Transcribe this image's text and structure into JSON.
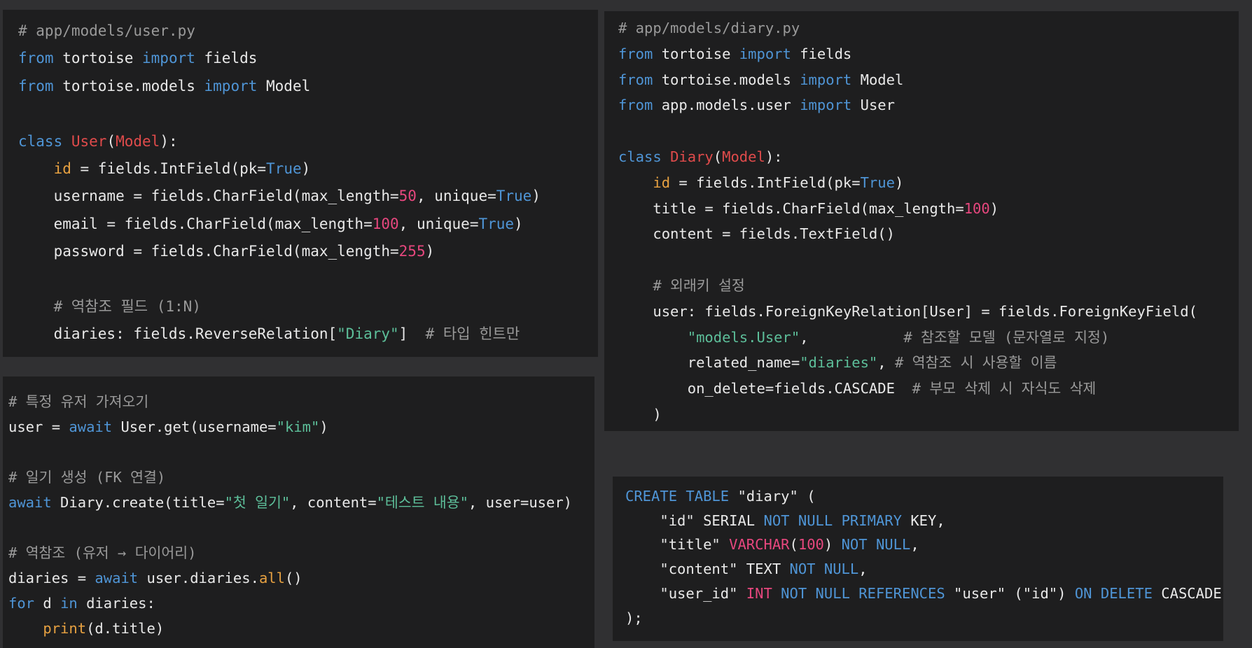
{
  "theme": {
    "background": "#303032",
    "panel": "#1e1e1f",
    "text": "#e9e9e9",
    "keyword": "#4f95d6",
    "class_name": "#e04b4b",
    "number": "#e7477e",
    "string": "#5dbf9a",
    "function": "#e7a141",
    "comment": "#9a9a9a"
  },
  "panels": [
    {
      "name": "user-model-code-panel",
      "language": "python",
      "lines": [
        [
          {
            "t": "# app/models/user.py",
            "c": "cmt"
          }
        ],
        [
          {
            "t": "from",
            "c": "kw"
          },
          {
            "t": " tortoise ",
            "c": "pl"
          },
          {
            "t": "import",
            "c": "kw"
          },
          {
            "t": " fields",
            "c": "pl"
          }
        ],
        [
          {
            "t": "from",
            "c": "kw"
          },
          {
            "t": " tortoise.models ",
            "c": "pl"
          },
          {
            "t": "import",
            "c": "kw"
          },
          {
            "t": " Model",
            "c": "pl"
          }
        ],
        [],
        [
          {
            "t": "class",
            "c": "kw"
          },
          {
            "t": " ",
            "c": "pl"
          },
          {
            "t": "User",
            "c": "cls"
          },
          {
            "t": "(",
            "c": "pl"
          },
          {
            "t": "Model",
            "c": "cls"
          },
          {
            "t": "):",
            "c": "pl"
          }
        ],
        [
          {
            "t": "    ",
            "c": "pl"
          },
          {
            "t": "id",
            "c": "fn"
          },
          {
            "t": " = fields.IntField(pk=",
            "c": "pl"
          },
          {
            "t": "True",
            "c": "kw"
          },
          {
            "t": ")",
            "c": "pl"
          }
        ],
        [
          {
            "t": "    username = fields.CharField(max_length=",
            "c": "pl"
          },
          {
            "t": "50",
            "c": "num"
          },
          {
            "t": ", unique=",
            "c": "pl"
          },
          {
            "t": "True",
            "c": "kw"
          },
          {
            "t": ")",
            "c": "pl"
          }
        ],
        [
          {
            "t": "    email = fields.CharField(max_length=",
            "c": "pl"
          },
          {
            "t": "100",
            "c": "num"
          },
          {
            "t": ", unique=",
            "c": "pl"
          },
          {
            "t": "True",
            "c": "kw"
          },
          {
            "t": ")",
            "c": "pl"
          }
        ],
        [
          {
            "t": "    password = fields.CharField(max_length=",
            "c": "pl"
          },
          {
            "t": "255",
            "c": "num"
          },
          {
            "t": ")",
            "c": "pl"
          }
        ],
        [],
        [
          {
            "t": "    # 역참조 필드 (1:N)",
            "c": "cmt"
          }
        ],
        [
          {
            "t": "    diaries: fields.ReverseRelation[",
            "c": "pl"
          },
          {
            "t": "\"Diary\"",
            "c": "str"
          },
          {
            "t": "]  ",
            "c": "pl"
          },
          {
            "t": "# 타입 힌트만",
            "c": "cmt"
          }
        ]
      ]
    },
    {
      "name": "diary-model-code-panel",
      "language": "python",
      "lines": [
        [
          {
            "t": "# app/models/diary.py",
            "c": "cmt"
          }
        ],
        [
          {
            "t": "from",
            "c": "kw"
          },
          {
            "t": " tortoise ",
            "c": "pl"
          },
          {
            "t": "import",
            "c": "kw"
          },
          {
            "t": " fields",
            "c": "pl"
          }
        ],
        [
          {
            "t": "from",
            "c": "kw"
          },
          {
            "t": " tortoise.models ",
            "c": "pl"
          },
          {
            "t": "import",
            "c": "kw"
          },
          {
            "t": " Model",
            "c": "pl"
          }
        ],
        [
          {
            "t": "from",
            "c": "kw"
          },
          {
            "t": " app.models.user ",
            "c": "pl"
          },
          {
            "t": "import",
            "c": "kw"
          },
          {
            "t": " User",
            "c": "pl"
          }
        ],
        [],
        [
          {
            "t": "class",
            "c": "kw"
          },
          {
            "t": " ",
            "c": "pl"
          },
          {
            "t": "Diary",
            "c": "cls"
          },
          {
            "t": "(",
            "c": "pl"
          },
          {
            "t": "Model",
            "c": "cls"
          },
          {
            "t": "):",
            "c": "pl"
          }
        ],
        [
          {
            "t": "    ",
            "c": "pl"
          },
          {
            "t": "id",
            "c": "fn"
          },
          {
            "t": " = fields.IntField(pk=",
            "c": "pl"
          },
          {
            "t": "True",
            "c": "kw"
          },
          {
            "t": ")",
            "c": "pl"
          }
        ],
        [
          {
            "t": "    title = fields.CharField(max_length=",
            "c": "pl"
          },
          {
            "t": "100",
            "c": "num"
          },
          {
            "t": ")",
            "c": "pl"
          }
        ],
        [
          {
            "t": "    content = fields.TextField()",
            "c": "pl"
          }
        ],
        [],
        [
          {
            "t": "    # 외래키 설정",
            "c": "cmt"
          }
        ],
        [
          {
            "t": "    user: fields.ForeignKeyRelation[User] = fields.ForeignKeyField(",
            "c": "pl"
          }
        ],
        [
          {
            "t": "        ",
            "c": "pl"
          },
          {
            "t": "\"models.User\"",
            "c": "str"
          },
          {
            "t": ",           ",
            "c": "pl"
          },
          {
            "t": "# 참조할 모델 (문자열로 지정)",
            "c": "cmt"
          }
        ],
        [
          {
            "t": "        related_name=",
            "c": "pl"
          },
          {
            "t": "\"diaries\"",
            "c": "str"
          },
          {
            "t": ", ",
            "c": "pl"
          },
          {
            "t": "# 역참조 시 사용할 이름",
            "c": "cmt"
          }
        ],
        [
          {
            "t": "        on_delete=fields.CASCADE  ",
            "c": "pl"
          },
          {
            "t": "# 부모 삭제 시 자식도 삭제",
            "c": "cmt"
          }
        ],
        [
          {
            "t": "    )",
            "c": "pl"
          }
        ]
      ]
    },
    {
      "name": "usage-code-panel",
      "language": "python",
      "lines": [
        [
          {
            "t": "# 특정 유저 가져오기",
            "c": "cmt"
          }
        ],
        [
          {
            "t": "user = ",
            "c": "pl"
          },
          {
            "t": "await",
            "c": "kw"
          },
          {
            "t": " User.get(username=",
            "c": "pl"
          },
          {
            "t": "\"kim\"",
            "c": "str"
          },
          {
            "t": ")",
            "c": "pl"
          }
        ],
        [],
        [
          {
            "t": "# 일기 생성 (FK 연결)",
            "c": "cmt"
          }
        ],
        [
          {
            "t": "await",
            "c": "kw"
          },
          {
            "t": " Diary.create(title=",
            "c": "pl"
          },
          {
            "t": "\"첫 일기\"",
            "c": "str"
          },
          {
            "t": ", content=",
            "c": "pl"
          },
          {
            "t": "\"테스트 내용\"",
            "c": "str"
          },
          {
            "t": ", user=user)",
            "c": "pl"
          }
        ],
        [],
        [
          {
            "t": "# 역참조 (유저 → 다이어리)",
            "c": "cmt"
          }
        ],
        [
          {
            "t": "diaries = ",
            "c": "pl"
          },
          {
            "t": "await",
            "c": "kw"
          },
          {
            "t": " user.diaries.",
            "c": "pl"
          },
          {
            "t": "all",
            "c": "fn"
          },
          {
            "t": "()",
            "c": "pl"
          }
        ],
        [
          {
            "t": "for",
            "c": "kw"
          },
          {
            "t": " d ",
            "c": "pl"
          },
          {
            "t": "in",
            "c": "kw"
          },
          {
            "t": " diaries:",
            "c": "pl"
          }
        ],
        [
          {
            "t": "    ",
            "c": "pl"
          },
          {
            "t": "print",
            "c": "fn"
          },
          {
            "t": "(d.title)",
            "c": "pl"
          }
        ]
      ]
    },
    {
      "name": "sql-create-table-panel",
      "language": "sql",
      "lines": [
        [
          {
            "t": "CREATE",
            "c": "kw"
          },
          {
            "t": " ",
            "c": "pl"
          },
          {
            "t": "TABLE",
            "c": "kw"
          },
          {
            "t": " \"diary\" (",
            "c": "pl"
          }
        ],
        [
          {
            "t": "    \"id\" SERIAL ",
            "c": "pl"
          },
          {
            "t": "NOT NULL",
            "c": "kw"
          },
          {
            "t": " ",
            "c": "pl"
          },
          {
            "t": "PRIMARY",
            "c": "kw"
          },
          {
            "t": " KEY,",
            "c": "pl"
          }
        ],
        [
          {
            "t": "    \"title\" ",
            "c": "pl"
          },
          {
            "t": "VARCHAR",
            "c": "num"
          },
          {
            "t": "(",
            "c": "pl"
          },
          {
            "t": "100",
            "c": "num"
          },
          {
            "t": ") ",
            "c": "pl"
          },
          {
            "t": "NOT NULL",
            "c": "kw"
          },
          {
            "t": ",",
            "c": "pl"
          }
        ],
        [
          {
            "t": "    \"content\" TEXT ",
            "c": "pl"
          },
          {
            "t": "NOT NULL",
            "c": "kw"
          },
          {
            "t": ",",
            "c": "pl"
          }
        ],
        [
          {
            "t": "    \"user_id\" ",
            "c": "pl"
          },
          {
            "t": "INT",
            "c": "num"
          },
          {
            "t": " ",
            "c": "pl"
          },
          {
            "t": "NOT NULL",
            "c": "kw"
          },
          {
            "t": " ",
            "c": "pl"
          },
          {
            "t": "REFERENCES",
            "c": "kw"
          },
          {
            "t": " \"user\" (\"id\") ",
            "c": "pl"
          },
          {
            "t": "ON DELETE",
            "c": "kw"
          },
          {
            "t": " CASCADE",
            "c": "pl"
          }
        ],
        [
          {
            "t": ");",
            "c": "pl"
          }
        ]
      ]
    }
  ]
}
